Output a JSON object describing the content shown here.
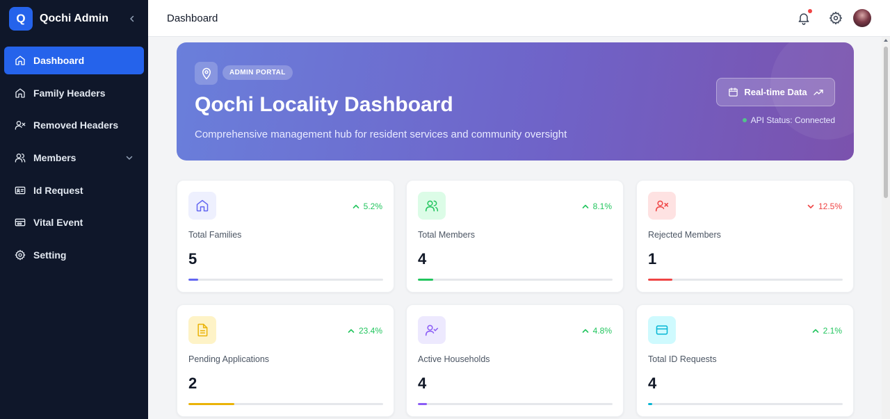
{
  "sidebar": {
    "logo_letter": "Q",
    "brand": "Qochi Admin",
    "items": [
      {
        "label": "Dashboard",
        "icon": "home-icon",
        "active": true
      },
      {
        "label": "Family Headers",
        "icon": "home-icon"
      },
      {
        "label": "Removed Headers",
        "icon": "user-x-icon"
      },
      {
        "label": "Members",
        "icon": "users-icon",
        "has_submenu": true
      },
      {
        "label": "Id Request",
        "icon": "id-card-icon"
      },
      {
        "label": "Vital Event",
        "icon": "wallet-icon"
      },
      {
        "label": "Setting",
        "icon": "gear-icon"
      }
    ]
  },
  "header": {
    "title": "Dashboard",
    "icons": [
      "bell-icon",
      "gear-icon",
      "avatar"
    ]
  },
  "hero": {
    "badge": "ADMIN PORTAL",
    "title": "Qochi Locality Dashboard",
    "subtitle": "Comprehensive management hub for resident services and community oversight",
    "button": "Real-time Data",
    "api_status": "API Status: Connected"
  },
  "cards": [
    {
      "label": "Total Families",
      "value": "5",
      "trend": "5.2%",
      "direction": "up",
      "progress": 0.05,
      "color": "#6366f1",
      "bg": "#eef0fe",
      "icon": "home-icon"
    },
    {
      "label": "Total Members",
      "value": "4",
      "trend": "8.1%",
      "direction": "up",
      "progress": 0.08,
      "color": "#22c55e",
      "bg": "#dcfce7",
      "icon": "users-icon"
    },
    {
      "label": "Rejected Members",
      "value": "1",
      "trend": "12.5%",
      "direction": "down",
      "progress": 0.125,
      "color": "#ef4444",
      "bg": "#fee2e2",
      "icon": "user-x-icon"
    },
    {
      "label": "Pending Applications",
      "value": "2",
      "trend": "23.4%",
      "direction": "up",
      "progress": 0.234,
      "color": "#eab308",
      "bg": "#fef3c7",
      "icon": "document-icon"
    },
    {
      "label": "Active Households",
      "value": "4",
      "trend": "4.8%",
      "direction": "up",
      "progress": 0.048,
      "color": "#8b5cf6",
      "bg": "#ede9fe",
      "icon": "user-check-icon"
    },
    {
      "label": "Total ID Requests",
      "value": "4",
      "trend": "2.1%",
      "direction": "up",
      "progress": 0.021,
      "color": "#06b6d4",
      "bg": "#cffafe",
      "icon": "card-icon"
    }
  ]
}
